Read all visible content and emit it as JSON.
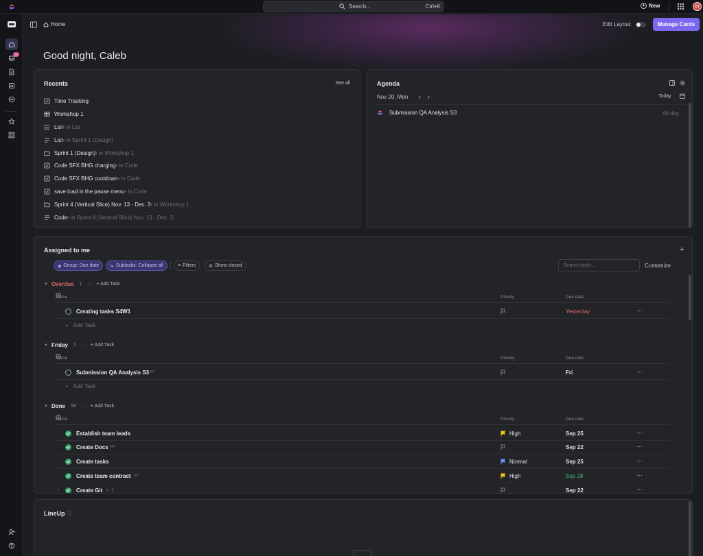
{
  "topbar": {
    "search_placeholder": "Search...",
    "search_shortcut": "Ctrl+K",
    "new_label": "New",
    "avatar_initials": "CT",
    "avatar_color": "#d0524b"
  },
  "sidebar": {
    "inbox_badge": "20",
    "items": [
      "home-icon",
      "inbox-icon",
      "docs-icon",
      "dashboards-icon",
      "more-icon",
      "favorites-icon",
      "spaces-icon",
      "invite-icon",
      "help-icon"
    ]
  },
  "header": {
    "breadcrumb": "Home",
    "edit_layout_label": "Edit Layout:",
    "manage_cards_label": "Manage Cards",
    "accent_color": "#7b68ee"
  },
  "greeting": "Good night, Caleb",
  "recents": {
    "title": "Recents",
    "see_all": "See all",
    "items": [
      {
        "icon": "task-icon",
        "name": "Time Tracking",
        "location": ""
      },
      {
        "icon": "table-icon",
        "name": "Workshop 1",
        "location": ""
      },
      {
        "icon": "list-icon",
        "name": "List",
        "location": " • in List"
      },
      {
        "icon": "list-icon",
        "name": "List",
        "location": " • in Sprint 1 (Design)"
      },
      {
        "icon": "folder-icon",
        "name": "Sprint 1 (Design)",
        "location": " • in Workshop 1"
      },
      {
        "icon": "checkbox-icon",
        "name": "Code SFX BHG charging",
        "location": " • in Code"
      },
      {
        "icon": "checkbox-icon",
        "name": "Code SFX BHG cooldown",
        "location": " • in Code"
      },
      {
        "icon": "checkbox-icon",
        "name": "save load in the pause menu",
        "location": " • in Code"
      },
      {
        "icon": "folder-icon",
        "name": "Sprint 4 (Vertical Slice) Nov. 13 - Dec. 3",
        "location": " • in Workshop 1"
      },
      {
        "icon": "list-icon",
        "name": "Code",
        "location": " • in Sprint 4 (Vertical Slice) Nov. 13 - Dec. 3"
      }
    ]
  },
  "agenda": {
    "title": "Agenda",
    "date": "Nov 20, Mon",
    "today": "Today",
    "events": [
      {
        "name": "Submission QA Analysis S3",
        "time": "All day"
      }
    ]
  },
  "assigned": {
    "title": "Assigned to me",
    "chips": {
      "group": "Group: Due date",
      "subtasks": "Subtasks: Collapse all",
      "filters": "Filters",
      "show_closed": "Show closed"
    },
    "search_placeholder": "Search tasks...",
    "customize": "Customize",
    "columns": {
      "name": "Name",
      "priority": "Priority",
      "due": "Due date"
    },
    "add_task": "Add Task",
    "groups": [
      {
        "name": "Overdue",
        "count": "1",
        "color": "#e06a6a",
        "tasks": [
          {
            "name": "Creating tasks S4W1",
            "priority": "",
            "due": "Yesterday",
            "due_style": "red",
            "done": false
          }
        ]
      },
      {
        "name": "Friday",
        "count": "1",
        "color": "#e6e7ea",
        "tasks": [
          {
            "name": "Submission QA Analysis S3",
            "priority": "",
            "due": "Fri",
            "due_style": "normal",
            "done": false
          }
        ]
      },
      {
        "name": "Done",
        "count": "58",
        "color": "#e6e7ea",
        "tasks": [
          {
            "name": "Establish team leads",
            "priority": "High",
            "priority_color": "#f5c518",
            "due": "Sep 25",
            "due_style": "normal",
            "done": true
          },
          {
            "name": "Create Docs",
            "priority": "",
            "due": "Sep 22",
            "due_style": "normal",
            "done": true
          },
          {
            "name": "Create tasks",
            "priority": "Normal",
            "priority_color": "#6a8cff",
            "due": "Sep 25",
            "due_style": "normal",
            "done": true
          },
          {
            "name": "Create team contract",
            "priority": "High",
            "priority_color": "#f5c518",
            "due": "Sep 28",
            "due_style": "green",
            "done": true
          },
          {
            "name": "Create Git",
            "subtask_count": "1",
            "priority": "",
            "due": "Sep 22",
            "due_style": "normal",
            "done": true
          }
        ]
      }
    ]
  },
  "lineup": {
    "title": "LineUp"
  }
}
